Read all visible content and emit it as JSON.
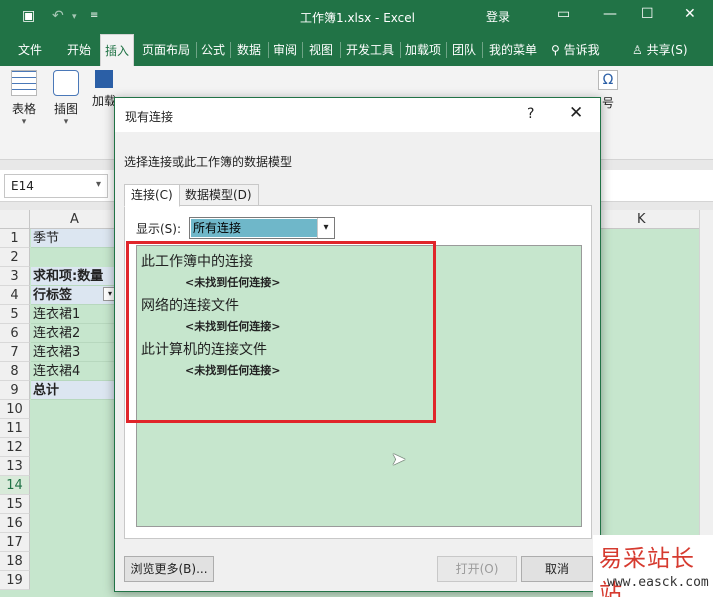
{
  "window": {
    "title": "工作簿1.xlsx  -  Excel",
    "login": "登录"
  },
  "tabs": [
    "文件",
    "开始",
    "插入",
    "页面布局",
    "公式",
    "数据",
    "审阅",
    "视图",
    "开发工具",
    "加载项",
    "团队",
    "我的菜单"
  ],
  "tell_me": "告诉我",
  "share": "共享(S)",
  "ribbon": {
    "groups": [
      "表格",
      "插图",
      "加载"
    ],
    "partial_right": "号"
  },
  "namebox": "E14",
  "grid": {
    "columns": [
      "A",
      "K"
    ],
    "rows": [
      {
        "num": "1",
        "value": "季节"
      },
      {
        "num": "2",
        "value": ""
      },
      {
        "num": "3",
        "value": "求和项:数量"
      },
      {
        "num": "4",
        "value": "行标签"
      },
      {
        "num": "5",
        "value": "连衣裙1"
      },
      {
        "num": "6",
        "value": "连衣裙2"
      },
      {
        "num": "7",
        "value": "连衣裙3"
      },
      {
        "num": "8",
        "value": "连衣裙4"
      },
      {
        "num": "9",
        "value": "总计"
      },
      {
        "num": "10",
        "value": ""
      },
      {
        "num": "11",
        "value": ""
      },
      {
        "num": "12",
        "value": ""
      },
      {
        "num": "13",
        "value": ""
      },
      {
        "num": "14",
        "value": ""
      },
      {
        "num": "15",
        "value": ""
      },
      {
        "num": "16",
        "value": ""
      },
      {
        "num": "17",
        "value": ""
      },
      {
        "num": "18",
        "value": ""
      },
      {
        "num": "19",
        "value": ""
      }
    ]
  },
  "dialog": {
    "title": "现有连接",
    "help": "?",
    "close": "✕",
    "subtitle": "选择连接或此工作簿的数据模型",
    "tabs": [
      "连接(C)",
      "数据模型(D)"
    ],
    "show_label": "显示(S):",
    "show_value": "所有连接",
    "sections": [
      {
        "heading": "此工作簿中的连接",
        "note": "<未找到任何连接>"
      },
      {
        "heading": "网络的连接文件",
        "note": "<未找到任何连接>"
      },
      {
        "heading": "此计算机的连接文件",
        "note": "<未找到任何连接>"
      }
    ],
    "browse_button": "浏览更多(B)...",
    "open_button": "打开(O)",
    "cancel_button": "取消"
  },
  "watermark": {
    "line1": "易采站长站",
    "line2": "www.easck.com"
  },
  "colors": {
    "excel_green": "#217346",
    "highlight_red": "#e0252a",
    "list_green": "#c6e6cd"
  }
}
